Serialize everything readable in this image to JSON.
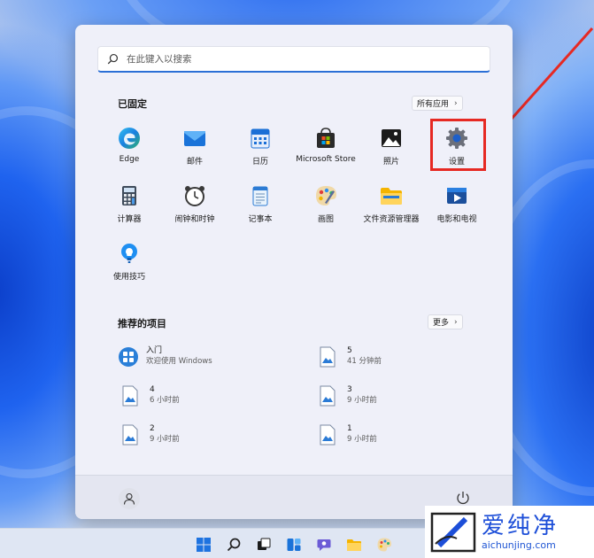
{
  "search": {
    "placeholder": "在此键入以搜索"
  },
  "pinned": {
    "title": "已固定",
    "all_apps_label": "所有应用",
    "apps": [
      {
        "label": "Edge",
        "icon": "edge-icon"
      },
      {
        "label": "邮件",
        "icon": "mail-icon"
      },
      {
        "label": "日历",
        "icon": "calendar-icon"
      },
      {
        "label": "Microsoft Store",
        "icon": "store-icon"
      },
      {
        "label": "照片",
        "icon": "photos-icon"
      },
      {
        "label": "设置",
        "icon": "settings-gear-icon"
      },
      {
        "label": "计算器",
        "icon": "calculator-icon"
      },
      {
        "label": "闹钟和时钟",
        "icon": "alarm-clock-icon"
      },
      {
        "label": "记事本",
        "icon": "notepad-icon"
      },
      {
        "label": "画图",
        "icon": "paint-icon"
      },
      {
        "label": "文件资源管理器",
        "icon": "file-explorer-icon"
      },
      {
        "label": "电影和电视",
        "icon": "movies-tv-icon"
      },
      {
        "label": "使用技巧",
        "icon": "tips-icon"
      }
    ]
  },
  "recommended": {
    "title": "推荐的项目",
    "more_label": "更多",
    "items": [
      {
        "name": "入门",
        "detail": "欢迎使用 Windows",
        "icon": "get-started-icon"
      },
      {
        "name": "5",
        "detail": "41 分钟前",
        "icon": "image-file-icon"
      },
      {
        "name": "4",
        "detail": "6 小时前",
        "icon": "image-file-icon"
      },
      {
        "name": "3",
        "detail": "9 小时前",
        "icon": "image-file-icon"
      },
      {
        "name": "2",
        "detail": "9 小时前",
        "icon": "image-file-icon"
      },
      {
        "name": "1",
        "detail": "9 小时前",
        "icon": "image-file-icon"
      }
    ]
  },
  "footer": {
    "user_icon": "user-avatar-icon",
    "power_icon": "power-icon"
  },
  "taskbar": {
    "icons": [
      "windows-start-icon",
      "search-icon",
      "task-view-icon",
      "widgets-icon",
      "chat-icon",
      "file-explorer-icon",
      "paint-icon"
    ]
  },
  "watermark": {
    "title": "爱纯净",
    "url": "aichunjing.com"
  },
  "colors": {
    "accent": "#2b6fd6",
    "highlight": "#e62923",
    "menu_bg": "#eff0f9"
  }
}
